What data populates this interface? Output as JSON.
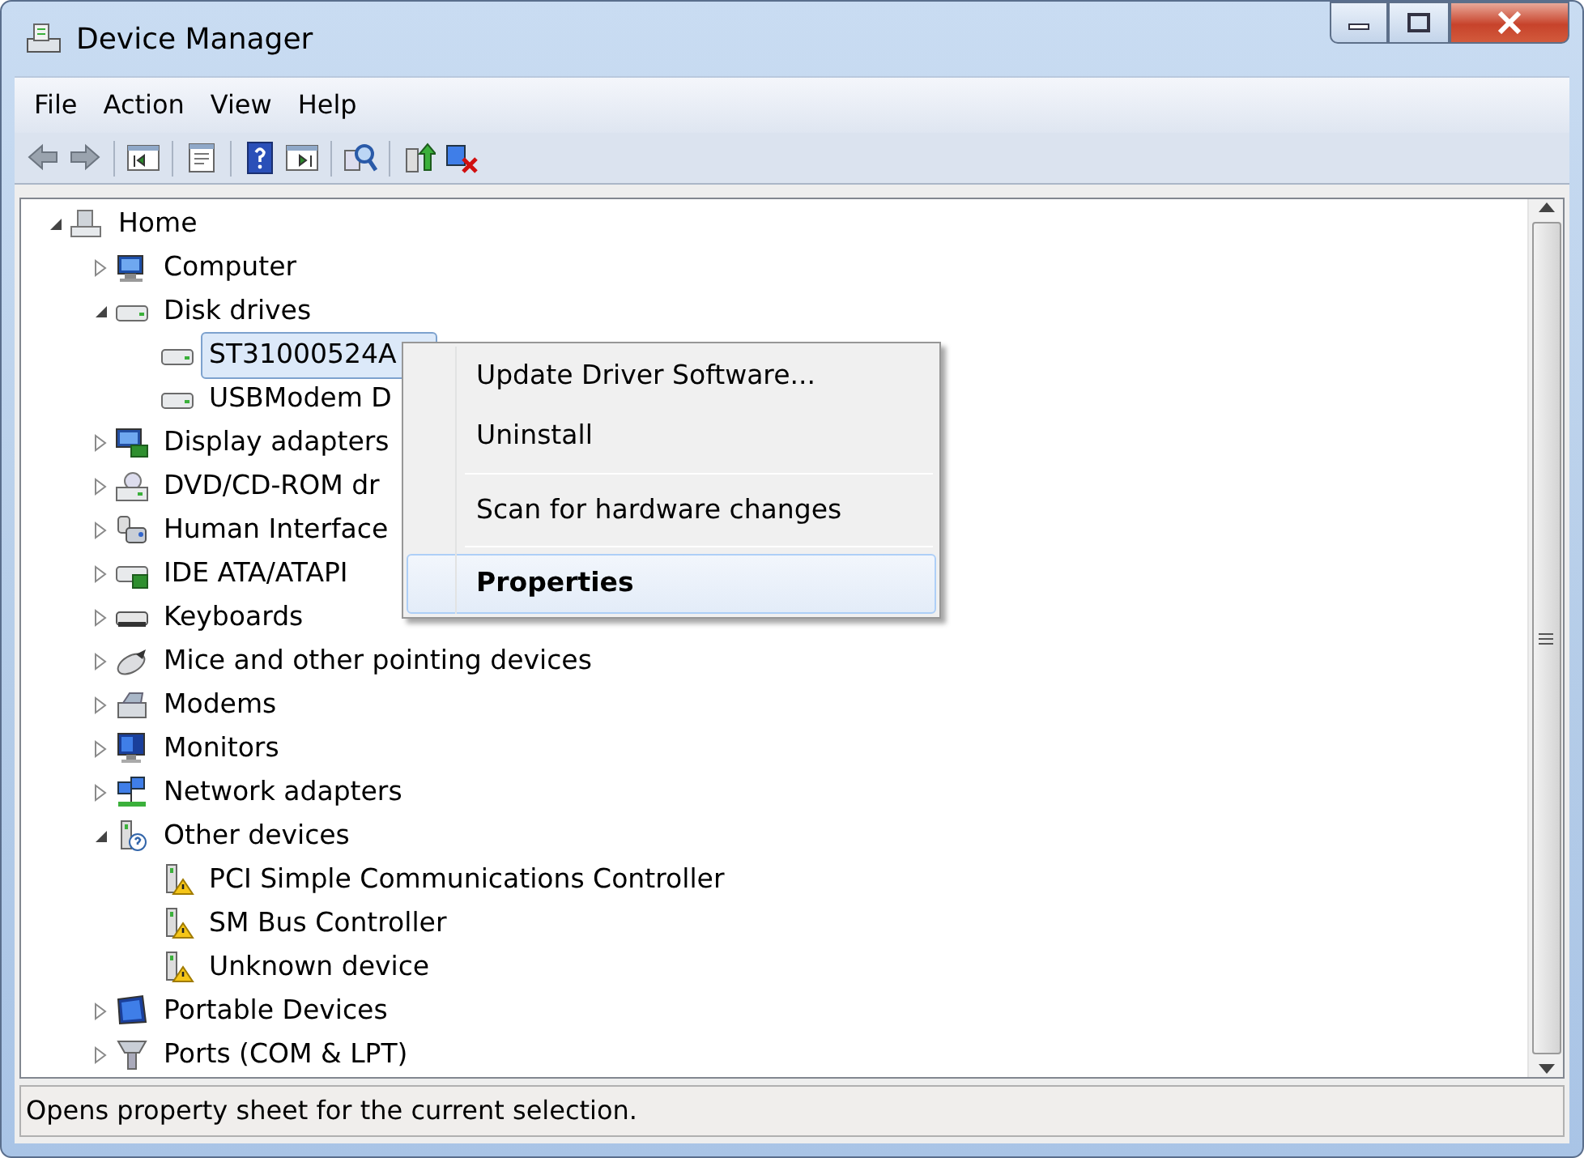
{
  "window": {
    "title": "Device Manager"
  },
  "menu_bar": [
    "File",
    "Action",
    "View",
    "Help"
  ],
  "toolbar": [
    {
      "kind": "back"
    },
    {
      "kind": "forward"
    },
    {
      "kind": "separator"
    },
    {
      "kind": "tree-pane"
    },
    {
      "kind": "separator"
    },
    {
      "kind": "properties"
    },
    {
      "kind": "separator"
    },
    {
      "kind": "help"
    },
    {
      "kind": "action-pane"
    },
    {
      "kind": "separator"
    },
    {
      "kind": "scan"
    },
    {
      "kind": "separator"
    },
    {
      "kind": "update"
    },
    {
      "kind": "uninstall"
    }
  ],
  "tree": [
    {
      "label": "Home",
      "kind": "home",
      "expanded": true,
      "selected": false,
      "children": [
        {
          "label": "Computer",
          "kind": "computer",
          "expanded": false,
          "selected": false
        },
        {
          "label": "Disk drives",
          "kind": "disk",
          "expanded": true,
          "selected": false,
          "children": [
            {
              "label": "ST31000524A",
              "kind": "disk",
              "selected": true
            },
            {
              "label": "USBModem D",
              "kind": "disk",
              "selected": false
            }
          ]
        },
        {
          "label": "Display adapters",
          "kind": "display",
          "expanded": false,
          "selected": false
        },
        {
          "label": "DVD/CD-ROM dr",
          "kind": "dvd",
          "expanded": false,
          "selected": false
        },
        {
          "label": "Human Interface",
          "kind": "hid",
          "expanded": false,
          "selected": false
        },
        {
          "label": "IDE ATA/ATAPI",
          "kind": "ide",
          "expanded": false,
          "selected": false
        },
        {
          "label": "Keyboards",
          "kind": "keyboard",
          "expanded": false,
          "selected": false
        },
        {
          "label": "Mice and other pointing devices",
          "kind": "mouse",
          "expanded": false,
          "selected": false
        },
        {
          "label": "Modems",
          "kind": "modem",
          "expanded": false,
          "selected": false
        },
        {
          "label": "Monitors",
          "kind": "monitor",
          "expanded": false,
          "selected": false
        },
        {
          "label": "Network adapters",
          "kind": "network",
          "expanded": false,
          "selected": false
        },
        {
          "label": "Other devices",
          "kind": "other",
          "expanded": true,
          "selected": false,
          "children": [
            {
              "label": "PCI Simple Communications Controller",
              "kind": "warning",
              "selected": false
            },
            {
              "label": "SM Bus Controller",
              "kind": "warning",
              "selected": false
            },
            {
              "label": "Unknown device",
              "kind": "warning",
              "selected": false
            }
          ]
        },
        {
          "label": "Portable Devices",
          "kind": "portable",
          "expanded": false,
          "selected": false
        },
        {
          "label": "Ports (COM & LPT)",
          "kind": "port",
          "expanded": false,
          "selected": false
        }
      ]
    }
  ],
  "context_menu": [
    {
      "kind": "item",
      "label": "Update Driver Software...",
      "default": false,
      "selected": false
    },
    {
      "kind": "item",
      "label": "Uninstall",
      "default": false,
      "selected": false
    },
    {
      "kind": "separator"
    },
    {
      "kind": "item",
      "label": "Scan for hardware changes",
      "default": false,
      "selected": false
    },
    {
      "kind": "separator"
    },
    {
      "kind": "item",
      "label": "Properties",
      "default": true,
      "selected": true
    }
  ],
  "status_bar": "Opens property sheet for the current selection."
}
